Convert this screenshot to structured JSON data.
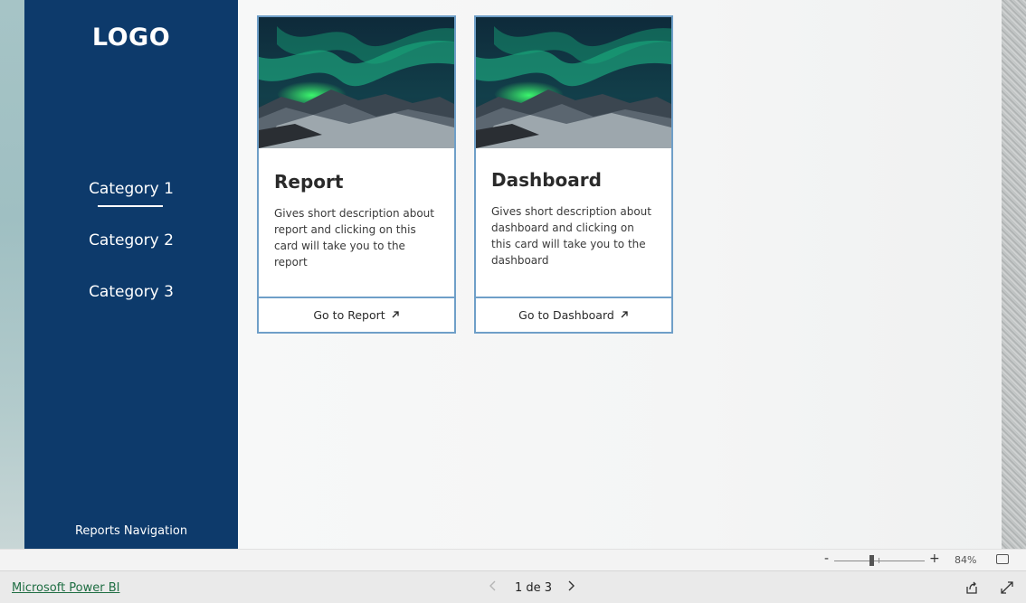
{
  "sidebar": {
    "logo": "LOGO",
    "categories": [
      "Category 1",
      "Category 2",
      "Category 3"
    ],
    "footer_label": "Reports Navigation"
  },
  "cards": [
    {
      "title": "Report",
      "description": "Gives short description about report and clicking on this card will take you to the report",
      "button_label": "Go to Report",
      "image": "aurora-borealis-image"
    },
    {
      "title": "Dashboard",
      "description": "Gives short description about dashboard and clicking on this card will take you to the dashboard",
      "button_label": "Go to Dashboard",
      "image": "aurora-borealis-image"
    }
  ],
  "zoom": {
    "minus": "-",
    "plus": "+",
    "level": "84%"
  },
  "footer": {
    "brand": "Microsoft Power BI",
    "page_indicator": "1 de 3"
  },
  "icons": {
    "arrow": "arrow-up-right-icon",
    "prev": "chevron-left-icon",
    "next": "chevron-right-icon",
    "fit": "fit-to-page-icon",
    "share": "share-icon",
    "expand": "expand-icon"
  },
  "colors": {
    "sidebar": "#0d3a6b",
    "card_border": "#6f9fc8",
    "brand_link": "#1f6e43"
  }
}
